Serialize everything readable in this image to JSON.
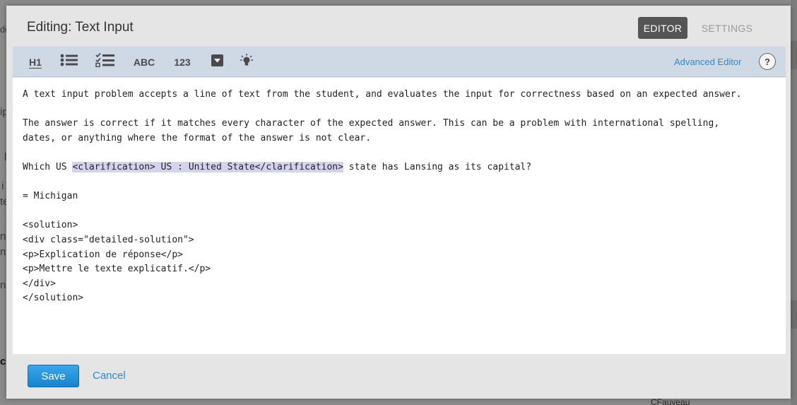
{
  "background": {
    "fragments": [
      "de",
      "ip",
      "l",
      "i",
      "te",
      "ns",
      "ng",
      "n l",
      "ck"
    ],
    "bottom_text": "CFauveau"
  },
  "modal": {
    "title": "Editing: Text Input",
    "modes": {
      "editor": "EDITOR",
      "settings": "SETTINGS"
    },
    "toolbar": {
      "heading_label": "H1",
      "abc_label": "ABC",
      "num_label": "123",
      "advanced_editor": "Advanced Editor",
      "help": "?"
    },
    "editor": {
      "line1": "A text input problem accepts a line of text from the student, and evaluates the input for correctness based on an expected answer.",
      "line3": "The answer is correct if it matches every character of the expected answer. This can be a problem with international spelling,",
      "line4": "dates, or anything where the format of the answer is not clear.",
      "line6_pre": "Which US ",
      "line6_hl": "<clarification> US : United State</clarification>",
      "line6_post": " state has Lansing as its capital?",
      "line8": "= Michigan",
      "line10": "<solution>",
      "line11": "<div class=\"detailed-solution\">",
      "line12": "<p>Explication de réponse</p>",
      "line13": "<p>Mettre le texte explicatif.</p>",
      "line14": "</div>",
      "line15": "</solution>"
    },
    "footer": {
      "save": "Save",
      "cancel": "Cancel"
    }
  },
  "colors": {
    "accent": "#1e90dc",
    "link": "#2a8ad2",
    "toolbar_bg": "#cfd9e6",
    "highlight": "#d3d3ee"
  }
}
